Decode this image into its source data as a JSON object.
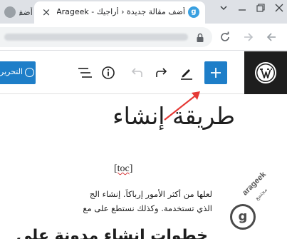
{
  "browser": {
    "inactive_tab": {
      "title": "أضف"
    },
    "active_tab": {
      "title": "أضف مقالة جديدة ‹ أراجيك - Arageek",
      "close_symbol": "×"
    },
    "favicon_letter": "g",
    "url_blurred": true
  },
  "editor": {
    "toolbar": {
      "toc_button_label": "التحرير",
      "add_block_icon": "plus-icon",
      "tools": [
        "edit-pen-icon",
        "redo-icon",
        "undo-icon",
        "info-icon",
        "list-view-icon"
      ]
    },
    "post_title": "طريقة إنشاء",
    "toc_shortcode": "[toc]",
    "paragraph_lines": [
      "لعلها من أكثر الأمور إرباكاً. إنشاء الج",
      "الذي تستخدمة. وكذلك نستطع على مع"
    ],
    "next_heading": "خطوات إنشاء مدونة على"
  },
  "watermark": {
    "brand": "arageek",
    "sub": "مجتمع",
    "letter": "g"
  },
  "colors": {
    "accent": "#1e7ec8",
    "wp_dark": "#1e1e1e",
    "arrow": "#e53935",
    "tabstrip": "#dee1e6"
  }
}
